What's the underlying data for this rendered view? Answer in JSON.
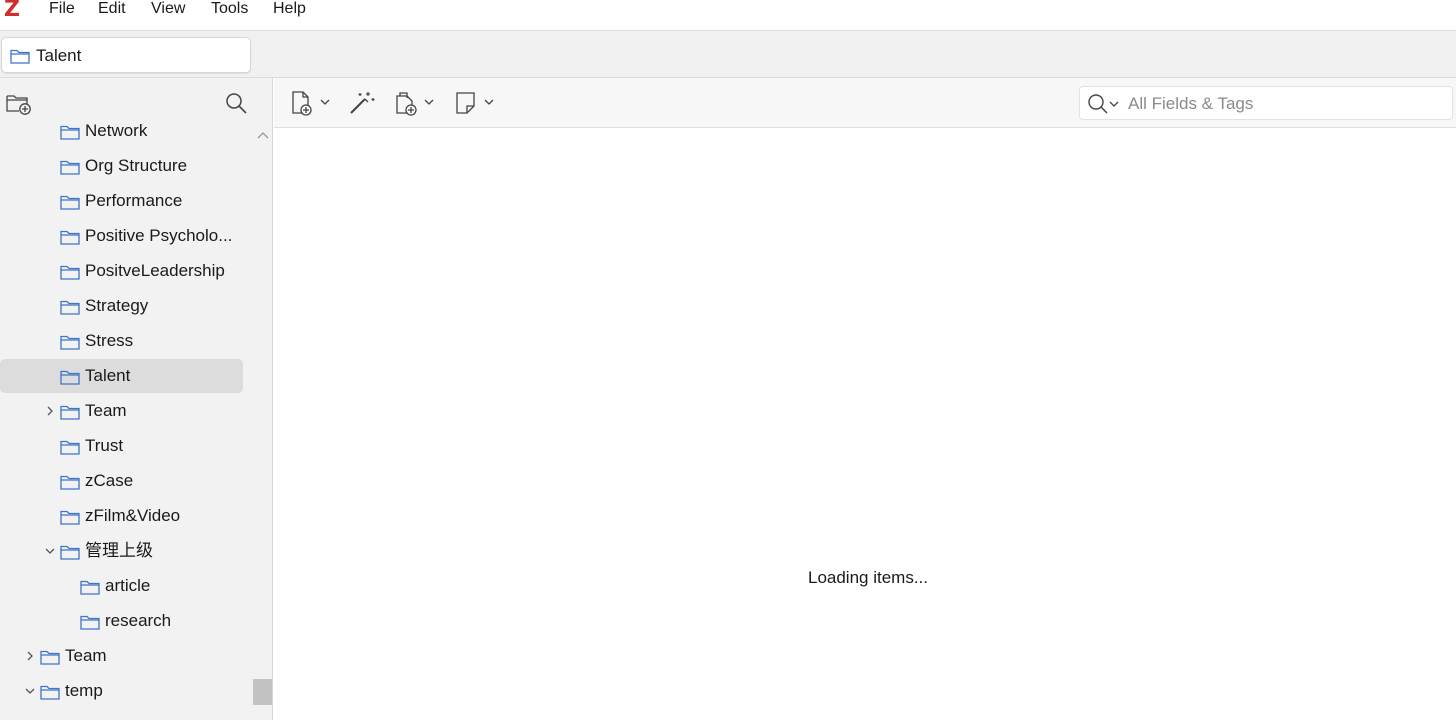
{
  "app": {
    "logo": "Z"
  },
  "menu": {
    "items": [
      "File",
      "Edit",
      "View",
      "Tools",
      "Help"
    ]
  },
  "tabs": [
    {
      "label": "Talent"
    }
  ],
  "sidebar": {
    "toolbar": {
      "new_collection_icon": "new-collection-icon",
      "search_icon": "search-icon"
    },
    "items": [
      {
        "label": "Network"
      },
      {
        "label": "Org Structure"
      },
      {
        "label": "Performance"
      },
      {
        "label": "Positive Psycholo..."
      },
      {
        "label": "PositveLeadership"
      },
      {
        "label": "Strategy"
      },
      {
        "label": "Stress"
      },
      {
        "label": "Talent",
        "selected": true
      },
      {
        "label": "Team",
        "twisty": "collapsed"
      },
      {
        "label": "Trust"
      },
      {
        "label": "zCase"
      },
      {
        "label": "zFilm&Video"
      },
      {
        "label": "管理上级",
        "twisty": "expanded"
      },
      {
        "label": "article"
      },
      {
        "label": "research"
      },
      {
        "label": "Team",
        "twisty": "collapsed"
      },
      {
        "label": "temp",
        "twisty": "expanded"
      }
    ]
  },
  "items_toolbar": {
    "buttons": [
      "new-item",
      "add-by-identifier",
      "add-attachment",
      "new-note"
    ],
    "search": {
      "placeholder": "All Fields & Tags",
      "value": ""
    }
  },
  "items": {
    "status": "Loading items..."
  },
  "colors": {
    "logo": "#d22d2d",
    "folder": "#3f74c9",
    "selected_row": "#dcdcdc"
  }
}
